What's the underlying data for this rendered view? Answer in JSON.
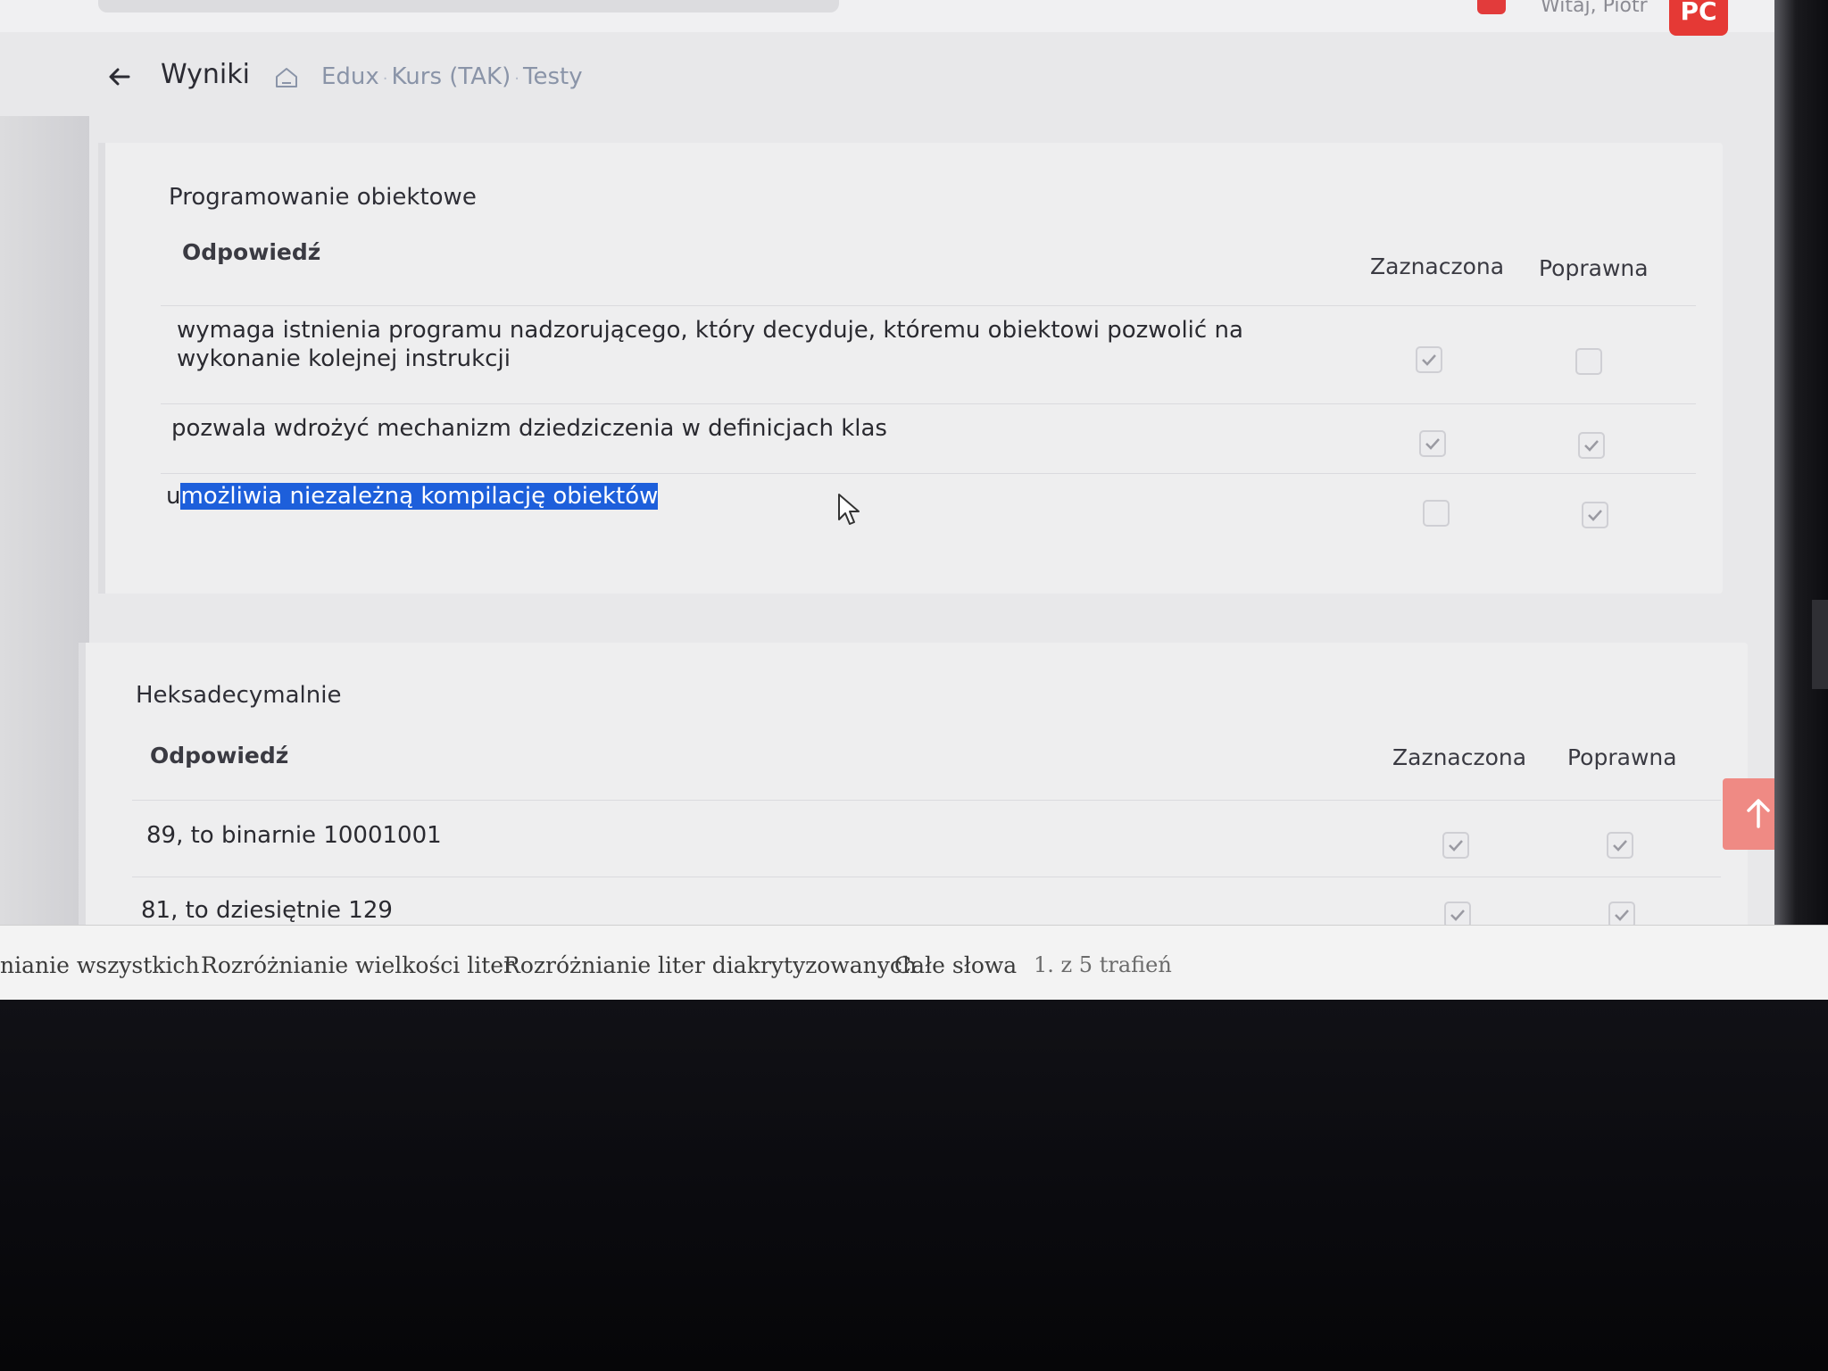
{
  "top": {
    "welcome": "Witaj, Piotr",
    "avatar_initials": "PC"
  },
  "header": {
    "title": "Wyniki",
    "breadcrumb": [
      "Edux",
      "Kurs (TAK)",
      "Testy"
    ]
  },
  "questions": [
    {
      "title": "Programowanie obiektowe",
      "col_answer": "Odpowiedź",
      "col_selected": "Zaznaczona",
      "col_correct": "Poprawna",
      "answers": [
        {
          "line1": "wymaga istnienia programu nadzorującego, który decyduje, któremu obiektowi pozwolić na",
          "line2": "wykonanie kolejnej instrukcji",
          "selected": true,
          "correct": false
        },
        {
          "line1": "pozwala wdrożyć mechanizm dziedziczenia w definicjach klas",
          "selected": true,
          "correct": true
        },
        {
          "prefix": "u",
          "highlighted": "możliwia niezależną kompilację obiektów",
          "selected": false,
          "correct": true
        }
      ]
    },
    {
      "title": "Heksadecymalnie",
      "col_answer": "Odpowiedź",
      "col_selected": "Zaznaczona",
      "col_correct": "Poprawna",
      "answers": [
        {
          "line1": "89, to binarnie 10001001",
          "selected": true,
          "correct": true
        },
        {
          "line1": "81, to dziesiętnie 129",
          "selected": true,
          "correct": true
        }
      ]
    }
  ],
  "findbar": {
    "highlight_all": "nianie wszystkich",
    "match_case": "Rozróżnianie wielkości liter",
    "match_diacritics": "Rozróżnianie liter diakrytyzowanych",
    "whole_words": "Całe słowa",
    "status": "1. z 5 trafień"
  },
  "colors": {
    "accent": "#e53935",
    "selection": "#1d5fdb",
    "scroll_top_button": "#ef8a84"
  }
}
